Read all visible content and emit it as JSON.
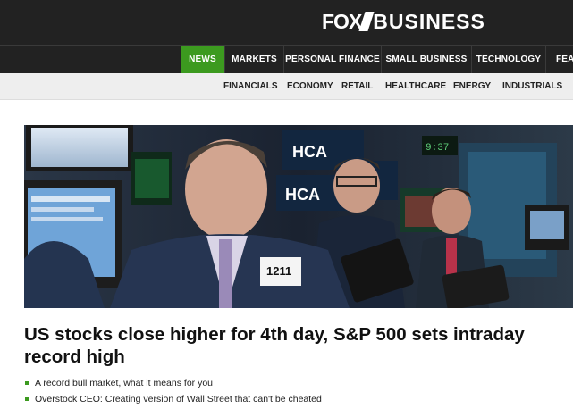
{
  "brand": {
    "logo_text_1": "FOX",
    "logo_text_2": "BUSINESS",
    "accent_color": "#3c9a1f",
    "header_bg": "#222222"
  },
  "nav": {
    "items": [
      {
        "label": "NEWS",
        "active": true
      },
      {
        "label": "MARKETS",
        "active": false
      },
      {
        "label": "PERSONAL FINANCE",
        "active": false
      },
      {
        "label": "SMALL BUSINESS",
        "active": false
      },
      {
        "label": "TECHNOLOGY",
        "active": false
      },
      {
        "label": "FEAT",
        "active": false
      }
    ]
  },
  "subnav": {
    "items": [
      "FINANCIALS",
      "ECONOMY",
      "RETAIL",
      "HEALTHCARE",
      "ENERGY",
      "INDUSTRIALS"
    ]
  },
  "hero": {
    "screen_text_1": "HCA",
    "screen_text_2": "HCA",
    "badge_number": "1211"
  },
  "article": {
    "headline": "US stocks close higher for 4th day, S&P 500 sets intraday record high",
    "bullets": [
      "A record bull market, what it means for you",
      "Overstock CEO: Creating version of Wall Street that can't be cheated"
    ]
  }
}
